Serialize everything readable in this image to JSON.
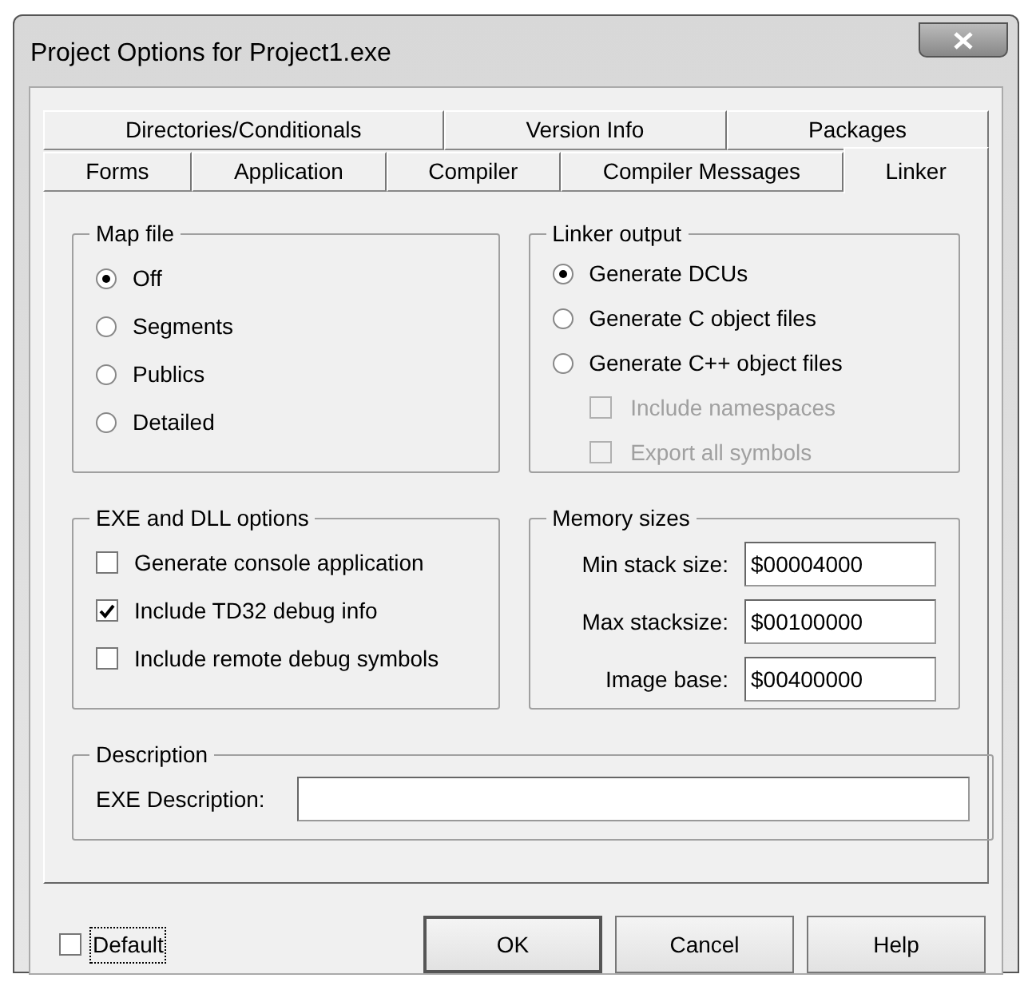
{
  "window": {
    "title": "Project Options for Project1.exe"
  },
  "tab_rows": [
    {
      "tabs": [
        {
          "label": "Directories/Conditionals",
          "selected": false
        },
        {
          "label": "Version Info",
          "selected": false
        },
        {
          "label": "Packages",
          "selected": false
        }
      ]
    },
    {
      "tabs": [
        {
          "label": "Forms",
          "selected": false
        },
        {
          "label": "Application",
          "selected": false
        },
        {
          "label": "Compiler",
          "selected": false
        },
        {
          "label": "Compiler Messages",
          "selected": false
        },
        {
          "label": "Linker",
          "selected": true
        }
      ]
    }
  ],
  "map_file": {
    "title": "Map file",
    "options": [
      {
        "label": "Off",
        "selected": true
      },
      {
        "label": "Segments",
        "selected": false
      },
      {
        "label": "Publics",
        "selected": false
      },
      {
        "label": "Detailed",
        "selected": false
      }
    ]
  },
  "linker_output": {
    "title": "Linker output",
    "options": [
      {
        "label": "Generate DCUs",
        "selected": true
      },
      {
        "label": "Generate C object files",
        "selected": false
      },
      {
        "label": "Generate C++ object files",
        "selected": false,
        "children": [
          {
            "label": "Include namespaces",
            "checked": false,
            "disabled": true
          },
          {
            "label": "Export all symbols",
            "checked": false,
            "disabled": true
          }
        ]
      }
    ]
  },
  "exe_dll_options": {
    "title": "EXE and DLL options",
    "options": [
      {
        "label": "Generate console application",
        "checked": false
      },
      {
        "label": "Include TD32 debug info",
        "checked": true
      },
      {
        "label": "Include remote debug symbols",
        "checked": false
      }
    ]
  },
  "memory_sizes": {
    "title": "Memory sizes",
    "fields": [
      {
        "label": "Min stack size:",
        "value": "$00004000"
      },
      {
        "label": "Max stacksize:",
        "value": "$00100000"
      },
      {
        "label": "Image base:",
        "value": "$00400000"
      }
    ]
  },
  "description": {
    "title": "Description",
    "field": {
      "label": "EXE Description:"
    }
  },
  "default_option": {
    "label": "Default",
    "checked": false,
    "focused": true
  },
  "buttons": [
    {
      "label": "OK",
      "default": true
    },
    {
      "label": "Cancel",
      "default": false
    },
    {
      "label": "Help",
      "default": false
    }
  ]
}
